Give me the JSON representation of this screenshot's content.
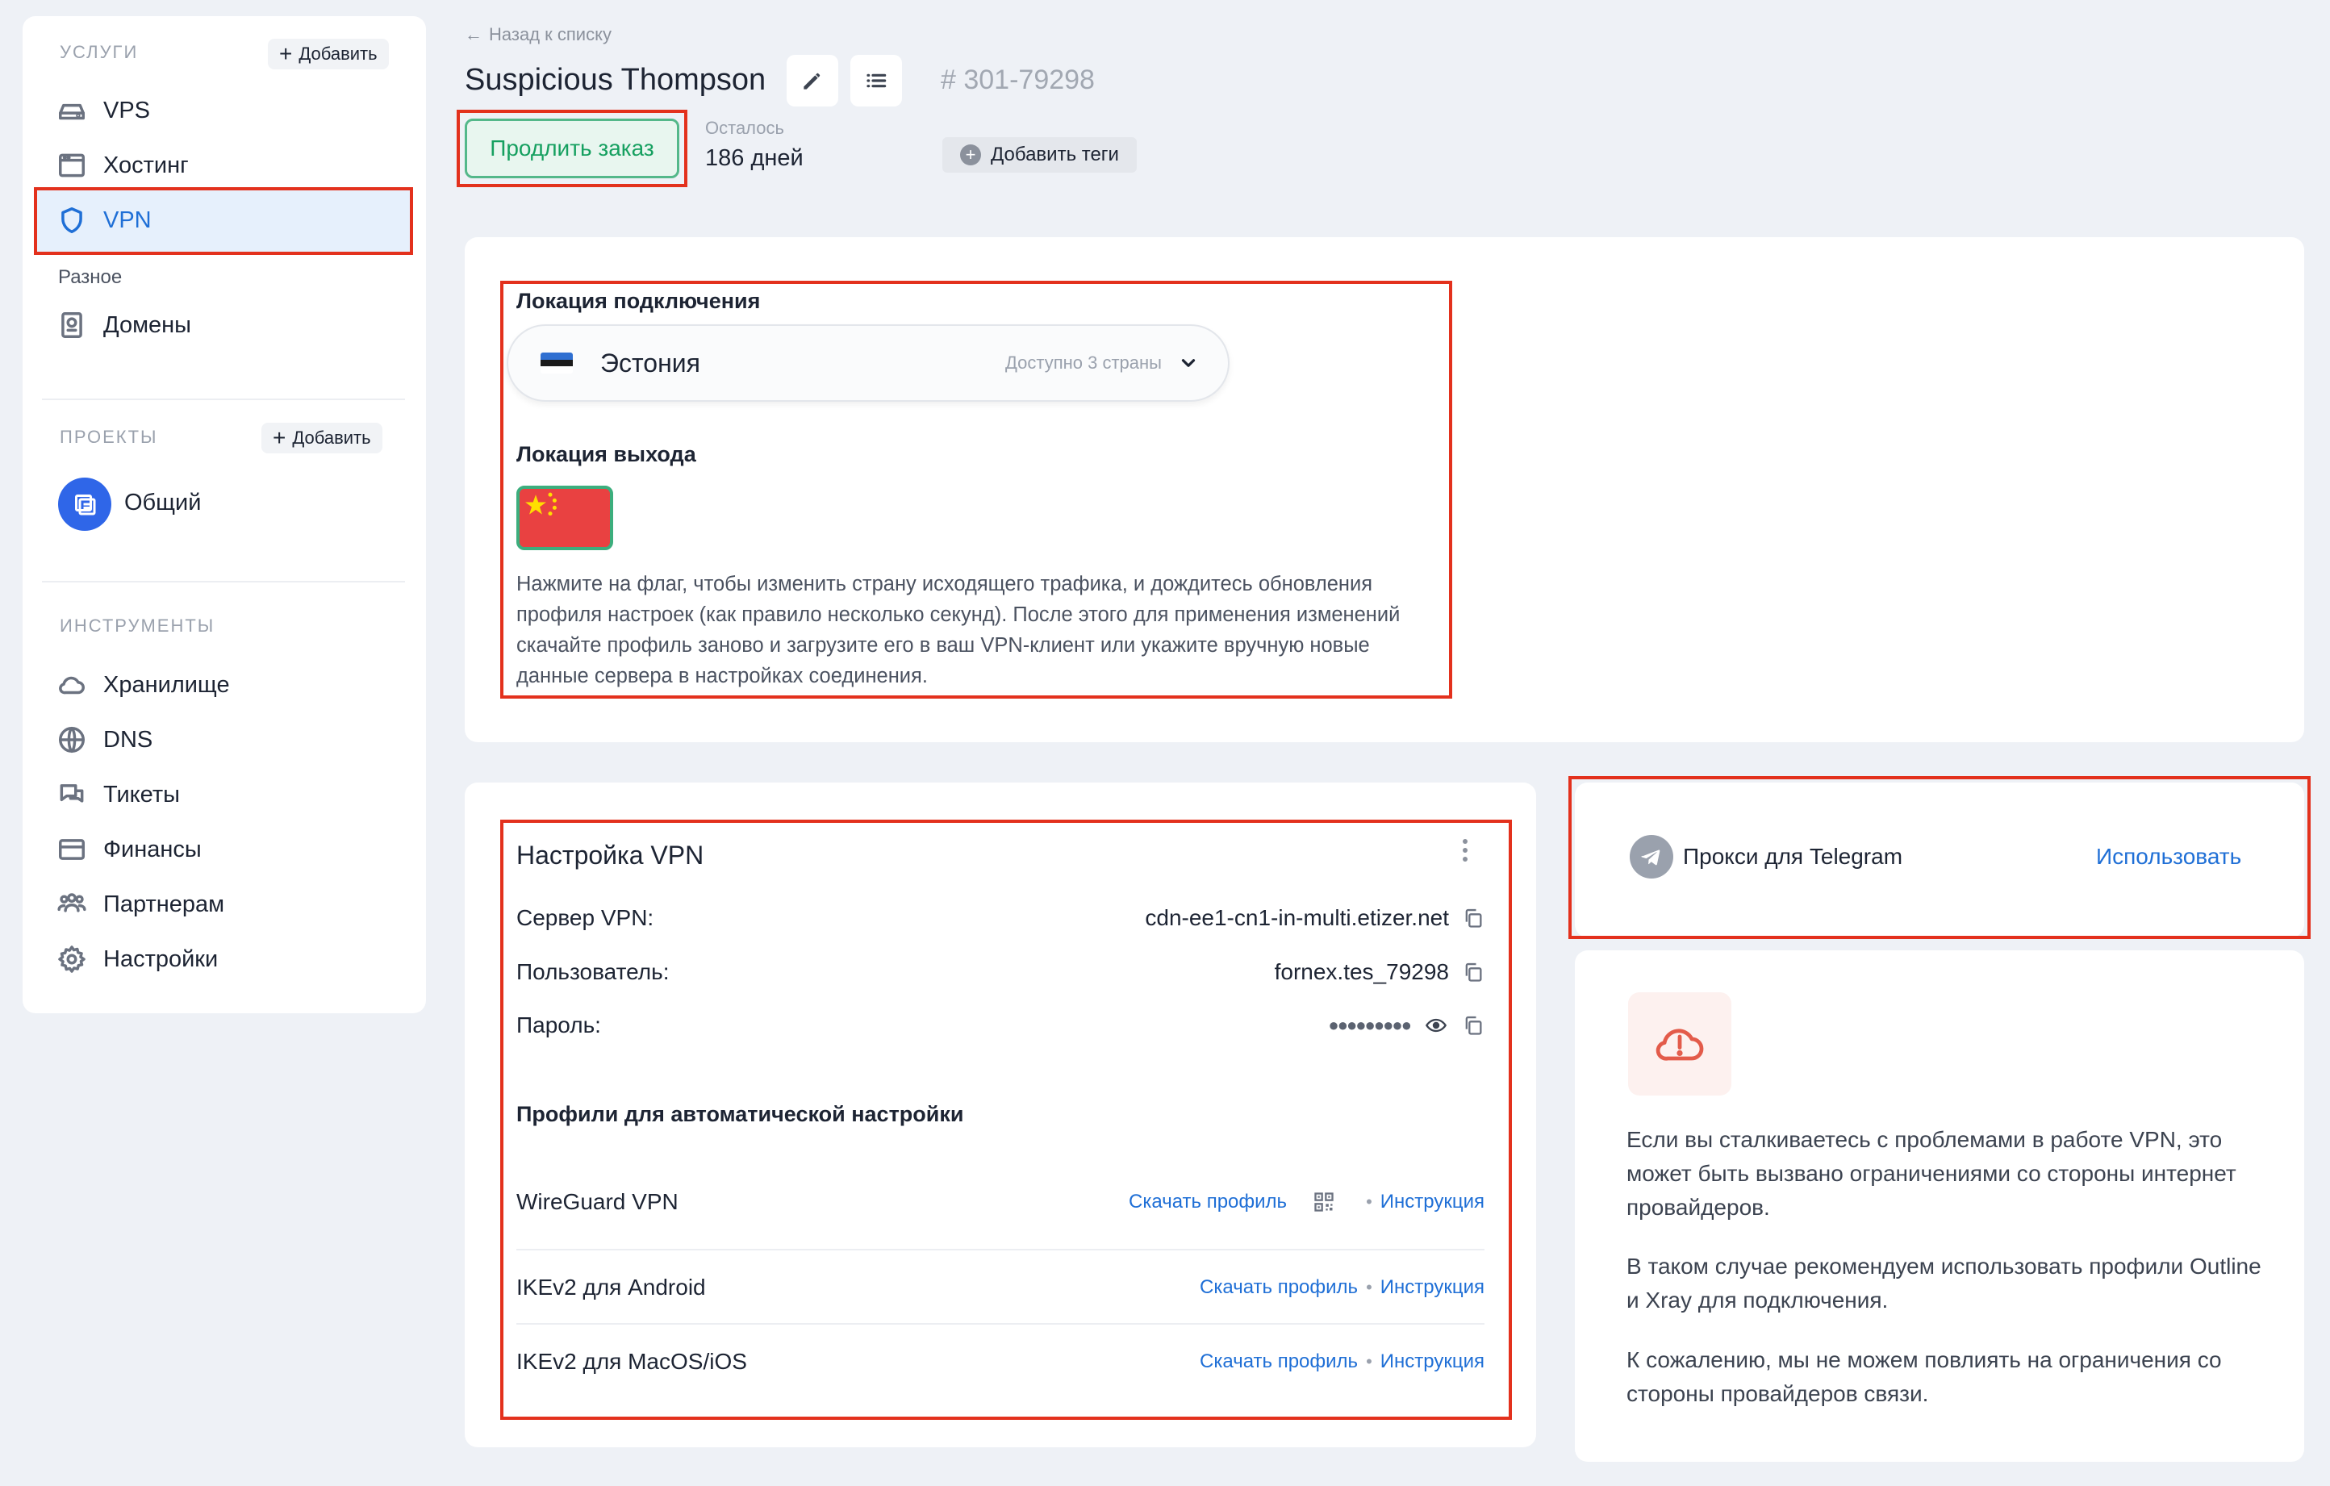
{
  "sidebar": {
    "services_label": "Услуги",
    "add_label": "Добавить",
    "items": [
      {
        "label": "VPS",
        "icon": "server-icon"
      },
      {
        "label": "Хостинг",
        "icon": "browser-window-icon"
      },
      {
        "label": "VPN",
        "icon": "shield-icon"
      }
    ],
    "misc_label": "Разное",
    "domains_label": "Домены",
    "projects_label": "Проекты",
    "project_name": "Общий",
    "tools_label": "Инструменты",
    "tools": [
      {
        "label": "Хранилище",
        "icon": "cloud-icon"
      },
      {
        "label": "DNS",
        "icon": "globe-icon"
      },
      {
        "label": "Тикеты",
        "icon": "chat-bubbles-icon"
      },
      {
        "label": "Финансы",
        "icon": "credit-card-icon"
      },
      {
        "label": "Партнерам",
        "icon": "users-icon"
      },
      {
        "label": "Настройки",
        "icon": "gear-icon"
      }
    ]
  },
  "header": {
    "back_label": "Назад к списку",
    "title": "Suspicious Thompson",
    "order_id": "# 301-79298",
    "renew_label": "Продлить заказ",
    "remaining_label": "Осталось",
    "remaining_value": "186 дней",
    "add_tags_label": "Добавить теги"
  },
  "location": {
    "connection_label": "Локация подключения",
    "selected_country": "Эстония",
    "available_text": "Доступно 3 страны",
    "exit_label": "Локация выхода",
    "help_text": "Нажмите на флаг, чтобы изменить страну исходящего трафика, и дождитесь обновления профиля настроек (как правило несколько секунд). После этого для применения изменений скачайте профиль заново и загрузите его в ваш VPN-клиент или укажите вручную новые данные сервера в настройках соединения."
  },
  "vpn_settings": {
    "title": "Настройка VPN",
    "server_label": "Сервер VPN:",
    "server_value": "cdn-ee1-cn1-in-multi.etizer.net",
    "user_label": "Пользователь:",
    "user_value": "fornex.tes_79298",
    "password_label": "Пароль:",
    "password_value": "●●●●●●●●●",
    "profiles_label": "Профили для автоматической настройки",
    "download_label": "Скачать профиль",
    "instructions_label": "Инструкция",
    "separator": "•",
    "profiles": [
      "WireGuard VPN",
      "IKEv2 для Android",
      "IKEv2 для MacOS/iOS"
    ]
  },
  "telegram": {
    "label": "Прокси для Telegram",
    "action": "Использовать"
  },
  "info": {
    "p1": "Если вы сталкиваетесь с проблемами в работе VPN, это может быть вызвано ограничениями со стороны интернет провайдеров.",
    "p2": "В таком случае рекомендуем использовать профили Outline и Xray для подключения.",
    "p3": "К сожалению, мы не можем повлиять на ограничения со стороны провайдеров связи."
  },
  "colors": {
    "accent": "#1f6fd6",
    "highlight_border": "#e3311d",
    "renew_green": "#16a060"
  }
}
